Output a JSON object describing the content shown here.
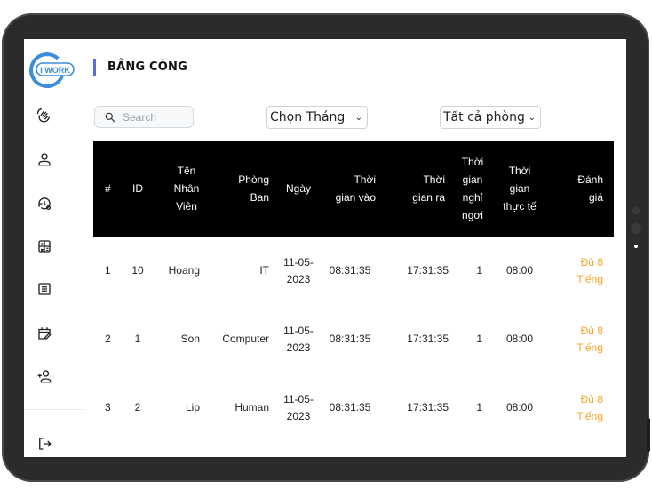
{
  "app": {
    "logo_text": "I WORK"
  },
  "sidebar": {
    "items": [
      {
        "icon": "hand-wave-icon"
      },
      {
        "icon": "user-icon"
      },
      {
        "icon": "history-settings-icon"
      },
      {
        "icon": "calculator-icon"
      },
      {
        "icon": "list-table-icon"
      },
      {
        "icon": "calendar-edit-icon"
      },
      {
        "icon": "add-user-icon"
      },
      {
        "icon": "logout-icon"
      }
    ]
  },
  "header": {
    "title": "BẢNG CÔNG"
  },
  "filters": {
    "search_placeholder": "Search",
    "month_select": "Chọn Tháng",
    "department_select": "Tất cả phòng ba"
  },
  "table": {
    "columns": [
      "#",
      "ID",
      "Tên Nhân Viên",
      "Phòng Ban",
      "Ngày",
      "Thời gian vào",
      "Thời gian ra",
      "Thời gian nghỉ ngơi",
      "Thời gian thực tế",
      "Đánh giá"
    ],
    "rows": [
      [
        "1",
        "10",
        "Hoang",
        "IT",
        "11-05-2023",
        "08:31:35",
        "17:31:35",
        "1",
        "08:00",
        "Đủ 8 Tiếng"
      ],
      [
        "2",
        "1",
        "Son",
        "Computer",
        "11-05-2023",
        "08:31:35",
        "17:31:35",
        "1",
        "08:00",
        "Đủ 8 Tiếng"
      ],
      [
        "3",
        "2",
        "Lip",
        "Human",
        "11-05-2023",
        "08:31:35",
        "17:31:35",
        "1",
        "08:00",
        "Đủ 8 Tiếng"
      ]
    ]
  },
  "colors": {
    "accent": "#5b6be8",
    "rating": "#f5a52a",
    "header_bg": "#000000",
    "logo": "#3b8ddb"
  }
}
